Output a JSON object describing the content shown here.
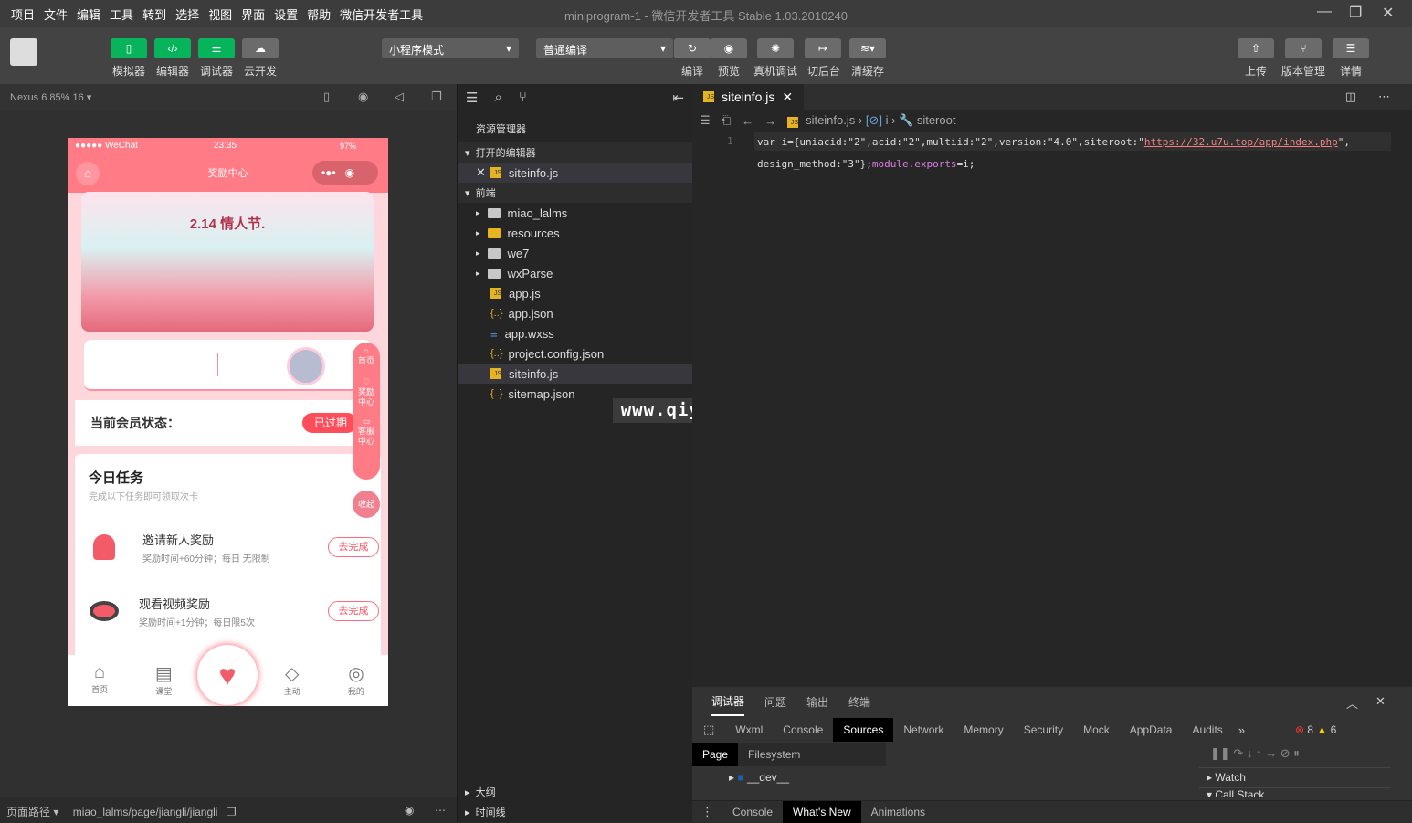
{
  "menu": [
    "项目",
    "文件",
    "编辑",
    "工具",
    "转到",
    "选择",
    "视图",
    "界面",
    "设置",
    "帮助",
    "微信开发者工具"
  ],
  "window_title": "miniprogram-1",
  "window_subtitle": "- 微信开发者工具 Stable 1.03.2010240",
  "toolbar": {
    "simulator": "模拟器",
    "editor": "编辑器",
    "debugger": "调试器",
    "cloud": "云开发",
    "mode": "小程序模式",
    "compile_mode": "普通编译",
    "compile": "编译",
    "preview": "预览",
    "remote_debug": "真机调试",
    "background": "切后台",
    "clear_cache": "清缓存",
    "upload": "上传",
    "version": "版本管理",
    "details": "详情"
  },
  "sim": {
    "device": "Nexus 6 85% 16 ▾"
  },
  "phone": {
    "carrier": "●●●●● WeChat",
    "time": "23:35",
    "battery": "97%",
    "nav_title": "奖励中心",
    "banner_text": "2.14 情人节.",
    "member_label": "当前会员状态：",
    "member_status": "已过期",
    "float_home": "首页",
    "float_reward": "奖励中心",
    "float_service": "客服中心",
    "collapse": "收起",
    "task_title": "今日任务",
    "task_sub": "完成以下任务即可领取次卡",
    "tasks": [
      {
        "name": "邀请新人奖励",
        "desc": "奖励时间+60分钟；每日 无限制",
        "btn": "去完成"
      },
      {
        "name": "观看视频奖励",
        "desc": "奖励时间+1分钟；每日限5次",
        "btn": "去完成"
      }
    ],
    "tabbar": [
      "首页",
      "课堂",
      "",
      "主动",
      "我的"
    ],
    "accent": "#ff7b86"
  },
  "explorer": {
    "title": "资源管理器",
    "open_editors": "打开的编辑器",
    "open_file": "siteinfo.js",
    "project": "前端",
    "folders": [
      "miao_lalms",
      "resources",
      "we7",
      "wxParse"
    ],
    "files": [
      {
        "name": "app.js",
        "type": "js"
      },
      {
        "name": "app.json",
        "type": "json"
      },
      {
        "name": "app.wxss",
        "type": "wxss"
      },
      {
        "name": "project.config.json",
        "type": "json"
      },
      {
        "name": "siteinfo.js",
        "type": "js"
      },
      {
        "name": "sitemap.json",
        "type": "json"
      }
    ],
    "outline": "大纲",
    "timeline": "时间线"
  },
  "watermark": "www.qiyuan7.com",
  "editor": {
    "tab": "siteinfo.js",
    "breadcrumb": [
      "siteinfo.js",
      "i",
      "siteroot"
    ],
    "line_number": "1",
    "line1_a": "var i={uniacid:\"2\",acid:\"2\",multiid:\"2\",version:\"4.0\",siteroot:\"",
    "line1_url": "https://32.u7u.top/app/index.php",
    "line1_b": "\",",
    "line2_a": "design_method:\"3\"};",
    "line2_b": "module.exports",
    "line2_c": "=i;"
  },
  "debug": {
    "tabs": [
      "调试器",
      "问题",
      "输出",
      "终端"
    ],
    "devtools": [
      "Wxml",
      "Console",
      "Sources",
      "Network",
      "Memory",
      "Security",
      "Mock",
      "AppData",
      "Audits"
    ],
    "errors": "8",
    "warnings": "6",
    "left_tabs": [
      "Page",
      "Filesystem"
    ],
    "tree_item": "__dev__",
    "watch": "Watch",
    "callstack": "Call Stack",
    "drawer": [
      "Console",
      "What's New",
      "Animations"
    ]
  },
  "status": {
    "label": "页面路径 ▾",
    "path": "miao_lalms/page/jiangli/jiangli"
  }
}
